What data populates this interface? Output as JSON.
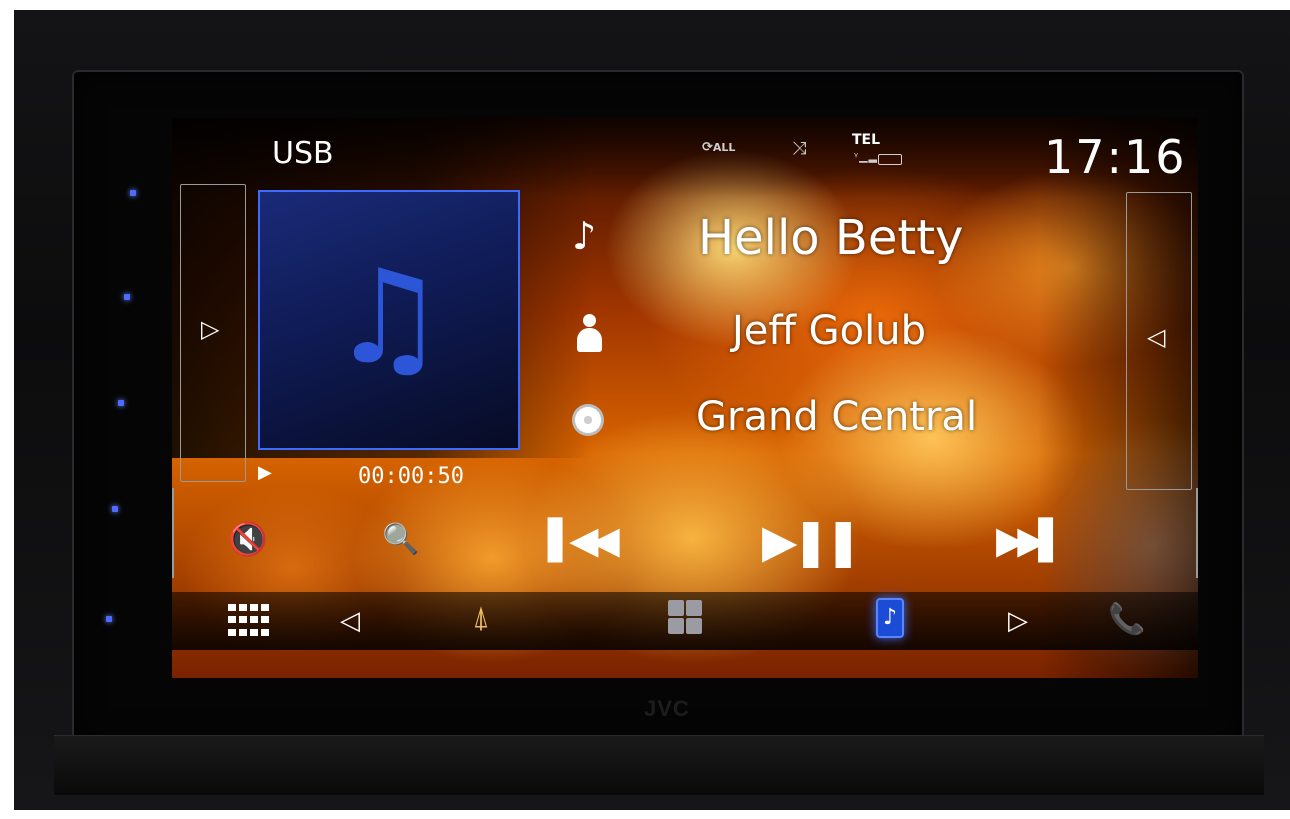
{
  "header": {
    "source": "USB",
    "status": {
      "repeat_label": "ALL",
      "tel_label": "TEL"
    },
    "clock": "17:16"
  },
  "now_playing": {
    "title": "Hello Betty",
    "artist": "Jeff Golub",
    "album": "Grand Central",
    "elapsed": "00:00:50"
  },
  "device": {
    "brand": "JVC"
  },
  "icons": {
    "mute": "mute-icon",
    "search": "search-icon",
    "prev": "skip-previous-icon",
    "play_pause": "play-pause-icon",
    "next": "skip-next-icon",
    "menu": "grid-menu-icon",
    "tuner": "antenna-icon",
    "widgets": "widgets-icon",
    "media": "music-icon",
    "phone": "phone-icon"
  },
  "colors": {
    "accent": "#3b6cff",
    "album_art_bg": "#1a2a78",
    "tuner": "#f0c060"
  }
}
